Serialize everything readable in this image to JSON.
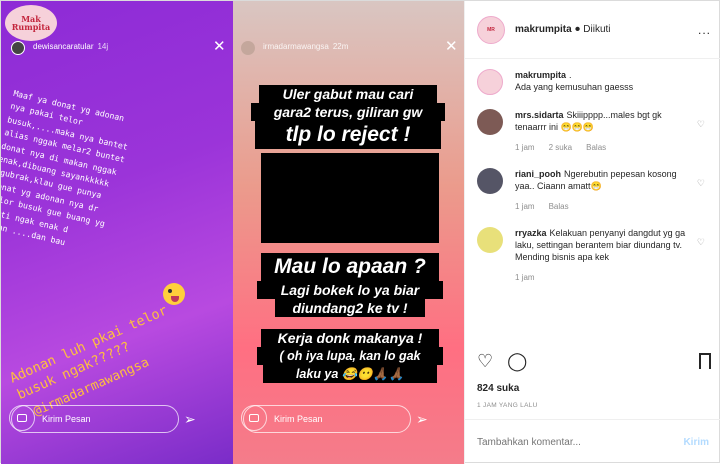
{
  "story_left": {
    "logo_text": "Mak Rumpita",
    "username": "dewisancaratular",
    "time": "14j",
    "note_text": "Maaf ya donat yg adonan\nnya pakai telor\nbusuk,....maka nya bantet\nalias nggak melar2 buntet\ndonat nya di makan nggak\nenak,dibuang sayankkkkk\n gubrak,klau gue punya\ndonat yg adonan nya dr\ntelor busuk gue buang yg\npasti ngak enak d\nmakan ....dan bau",
    "big_text": "Adonan luh pkai telor\nbusuk ngak?????",
    "mention": "@irmadarmawangsa",
    "message_placeholder": "Kirim Pesan"
  },
  "story_right": {
    "username": "irmadarmawangsa",
    "time": "22m",
    "lines": [
      "Uler gabut mau cari",
      "gara2 terus, giliran gw",
      "tlp lo reject !",
      "Mau lo apaan ?",
      "Lagi bokek lo ya biar",
      "diundang2 ke tv !",
      "Kerja donk makanya !",
      "( oh iya lupa, kan lo gak",
      "laku ya"
    ],
    "message_placeholder": "Kirim Pesan"
  },
  "header": {
    "account": "makrumpita",
    "separator": "•",
    "follow_status": "Diikuti",
    "more": "..."
  },
  "comments": [
    {
      "user": "makrumpita",
      "text": ".",
      "text2": "Ada yang kemusuhan gaesss",
      "avatar_color": "#f6d1da"
    },
    {
      "user": "mrs.sidarta",
      "text": "Skiiipppp...males bgt gk tenaarrr ini 😁😁😁",
      "time": "1 jam",
      "likes": "2 suka",
      "reply": "Balas",
      "avatar_color": "#7d5a55"
    },
    {
      "user": "riani_pooh",
      "text": "Ngerebutin pepesan kosong yaa.. Ciaann amatt😁",
      "time": "1 jam",
      "reply": "Balas",
      "avatar_color": "#556"
    },
    {
      "user": "rryazka",
      "text": "Kelakuan penyanyi dangdut yg ga laku, settingan berantem biar diundang tv. Mending bisnis apa kek",
      "time": "1 jam",
      "avatar_color": "#e8e07a"
    }
  ],
  "likes": "824 suka",
  "time_ago": "1 JAM YANG LALU",
  "add_comment_placeholder": "Tambahkan komentar...",
  "post_button": "Kirim"
}
